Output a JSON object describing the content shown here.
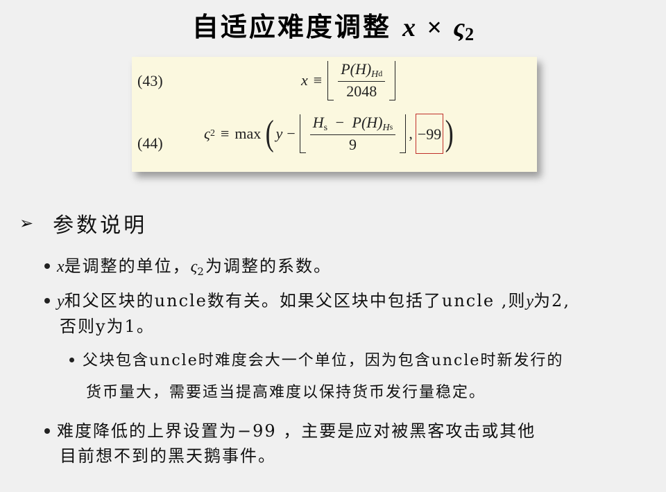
{
  "title": {
    "text": "自适应难度调整",
    "math_x": "x",
    "times": "×",
    "math_sigma": "ς",
    "math_sub": "2"
  },
  "equations": [
    {
      "number": "(43)",
      "lhs": "x",
      "rel": "≡",
      "num_main": "P(H)",
      "num_sub": "H",
      "num_subsub": "d",
      "den": "2048"
    },
    {
      "number": "(44)",
      "lhs": "ς",
      "lhs_sub": "2",
      "rel": "≡",
      "func": "max",
      "y": "y",
      "minus": "−",
      "num_h": "H",
      "num_h_sub": "s",
      "num_minus": "−",
      "num_p": "P(H)",
      "num_p_sub": "H",
      "num_p_subsub": "s",
      "den": "9",
      "comma": ",",
      "bound": "−99",
      "highlight_color": "#c0302a"
    }
  ],
  "section": {
    "arrow": "➢",
    "heading": "参数说明"
  },
  "bullets": {
    "b1": {
      "x": "x",
      "text1": "是调整的单位，",
      "sigma": "ς",
      "sigma_sub": "2",
      "text2": "为调整的系数。"
    },
    "b2": {
      "y": "y",
      "text1": "和父区块的uncle数有关。如果父区块中包括了uncle ,则",
      "y2": "y",
      "text2": "为2,",
      "line2": "否则y为1。"
    },
    "sub1": {
      "line1": "父块包含uncle时难度会大一个单位，因为包含uncle时新发行的",
      "line2": "货币量大，需要适当提高难度以保持货币发行量稳定。"
    },
    "b3": {
      "line1": "难度降低的上界设置为−99 ，主要是应对被黑客攻击或其他",
      "line2": "目前想不到的黑天鹅事件。"
    }
  }
}
